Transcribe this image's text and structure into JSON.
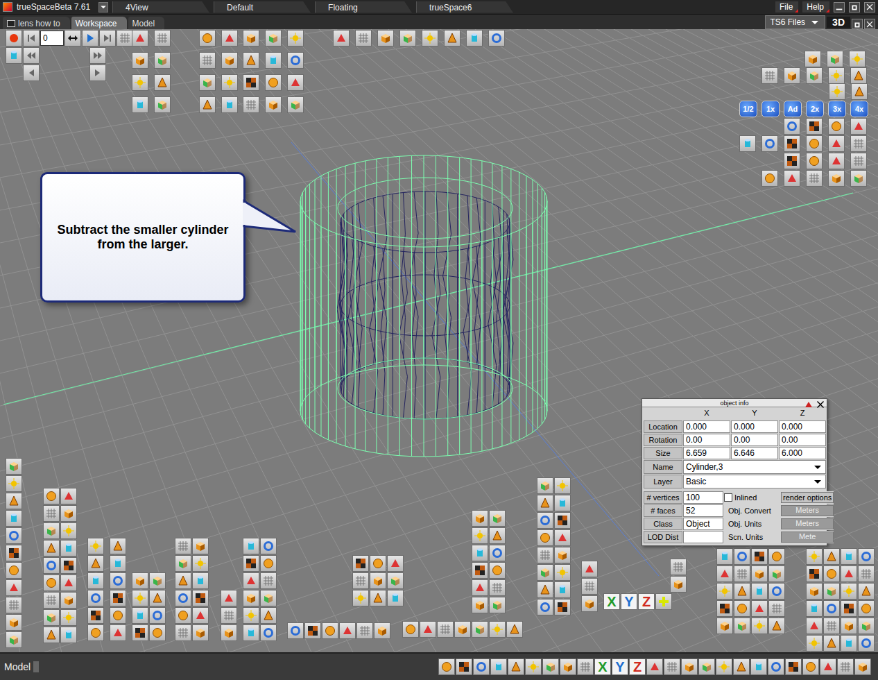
{
  "window": {
    "title": "trueSpaceBeta 7.61",
    "menu": [
      "File",
      "Help"
    ]
  },
  "layout_tabs": [
    {
      "label": "4View",
      "selected": false
    },
    {
      "label": "Default",
      "selected": false
    },
    {
      "label": "Floating",
      "selected": false
    },
    {
      "label": "trueSpace6",
      "selected": false
    }
  ],
  "workspace_tabs": [
    {
      "label": "lens how to",
      "selected": false
    },
    {
      "label": "Workspace",
      "selected": true
    },
    {
      "label": "Model",
      "selected": false
    }
  ],
  "library_button": "TS6 Files",
  "view_mode": "3D",
  "frame_counter": "0",
  "callout": "Subtract the smaller cylinder from the larger.",
  "render_buttons": [
    "1/2",
    "1x",
    "Ad",
    "2x",
    "3x",
    "4x"
  ],
  "axis_buttons": [
    {
      "label": "X",
      "color": "#1f9a2a"
    },
    {
      "label": "Y",
      "color": "#1e6fd0"
    },
    {
      "label": "Z",
      "color": "#d02a20"
    }
  ],
  "object_info": {
    "title": "object info",
    "columns": [
      "X",
      "Y",
      "Z"
    ],
    "rows": [
      {
        "label": "Location",
        "values": [
          "0.000",
          "0.000",
          "0.000"
        ]
      },
      {
        "label": "Rotation",
        "values": [
          "0.00",
          "0.00",
          "0.00"
        ]
      },
      {
        "label": "Size",
        "values": [
          "6.659",
          "6.646",
          "6.000"
        ]
      }
    ],
    "name": {
      "label": "Name",
      "value": "Cylinder,3"
    },
    "layer": {
      "label": "Layer",
      "value": "Basic"
    },
    "vertices": {
      "label": "# vertices",
      "value": "100"
    },
    "inlined": {
      "label": "Inlined",
      "checked": false
    },
    "render_options": "render options",
    "faces": {
      "label": "# faces",
      "value": "52"
    },
    "class": {
      "label": "Class",
      "value": "Object"
    },
    "lod": {
      "label": "LOD Dist",
      "value": ""
    },
    "units": [
      {
        "label": "Obj. Convert",
        "value": "Meters"
      },
      {
        "label": "Obj. Units",
        "value": "Meters"
      },
      {
        "label": "Scn. Units",
        "value": "Mete"
      }
    ]
  },
  "status_bar": {
    "mode": "Model",
    "axis_buttons": [
      {
        "label": "X",
        "color": "#1f9a2a"
      },
      {
        "label": "Y",
        "color": "#1e6fd0"
      },
      {
        "label": "Z",
        "color": "#d02a20"
      }
    ]
  }
}
